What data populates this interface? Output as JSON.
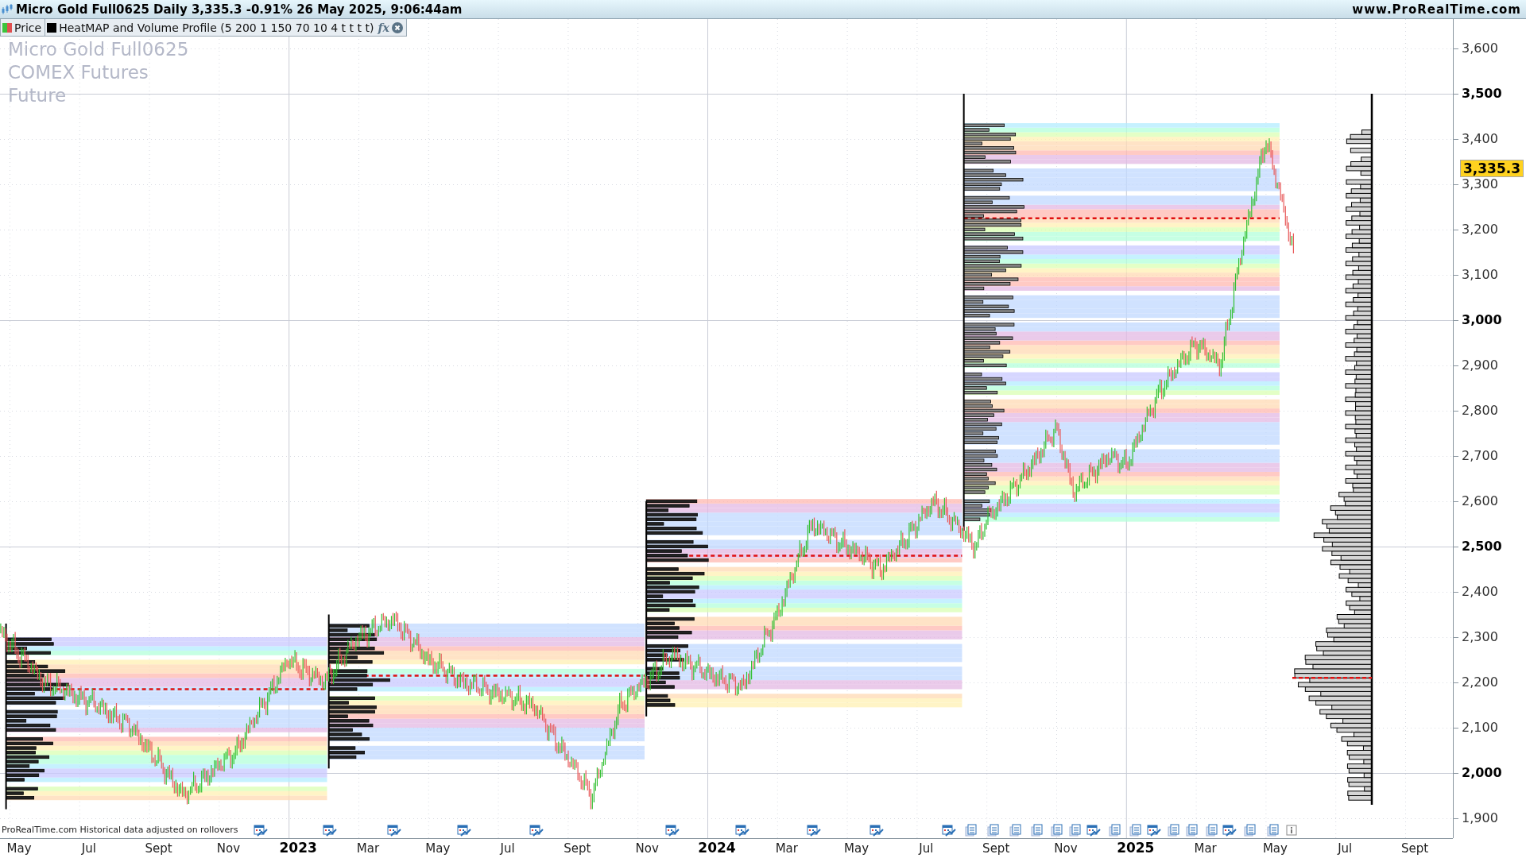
{
  "title_bar": {
    "title": "Micro Gold Full0625 Daily 3,335.3 -0.91% 26 May 2025, 9:06:44am",
    "website": "www.ProRealTime.com"
  },
  "legend": {
    "items": [
      {
        "kind": "price",
        "label": "Price"
      },
      {
        "kind": "indicator",
        "label": "HeatMAP and Volume Profile (5 200 1 150 70 10 4 t t t t)"
      }
    ],
    "formula_icon": "fx"
  },
  "watermark": [
    "Micro Gold Full0625",
    "COMEX Futures",
    "Future"
  ],
  "y_axis": {
    "labels": [
      {
        "label": "3,600",
        "major": false
      },
      {
        "label": "3,500",
        "major": true
      },
      {
        "label": "3,400",
        "major": false
      },
      {
        "label": "3,300",
        "major": false
      },
      {
        "label": "3,200",
        "major": false
      },
      {
        "label": "3,100",
        "major": false
      },
      {
        "label": "3,000",
        "major": true
      },
      {
        "label": "2,900",
        "major": false
      },
      {
        "label": "2,800",
        "major": false
      },
      {
        "label": "2,700",
        "major": false
      },
      {
        "label": "2,600",
        "major": false
      },
      {
        "label": "2,500",
        "major": true
      },
      {
        "label": "2,400",
        "major": false
      },
      {
        "label": "2,300",
        "major": false
      },
      {
        "label": "2,200",
        "major": false
      },
      {
        "label": "2,100",
        "major": false
      },
      {
        "label": "2,000",
        "major": true
      },
      {
        "label": "1,900",
        "major": false
      }
    ],
    "last_price": "3,335.3"
  },
  "x_axis": {
    "labels": [
      {
        "label": "May",
        "year": false
      },
      {
        "label": "Jul",
        "year": false
      },
      {
        "label": "Sept",
        "year": false
      },
      {
        "label": "Nov",
        "year": false
      },
      {
        "label": "2023",
        "year": true
      },
      {
        "label": "Mar",
        "year": false
      },
      {
        "label": "May",
        "year": false
      },
      {
        "label": "Jul",
        "year": false
      },
      {
        "label": "Sept",
        "year": false
      },
      {
        "label": "Nov",
        "year": false
      },
      {
        "label": "2024",
        "year": true
      },
      {
        "label": "Mar",
        "year": false
      },
      {
        "label": "May",
        "year": false
      },
      {
        "label": "Jul",
        "year": false
      },
      {
        "label": "Sept",
        "year": false
      },
      {
        "label": "Nov",
        "year": false
      },
      {
        "label": "2025",
        "year": true
      },
      {
        "label": "Mar",
        "year": false
      },
      {
        "label": "May",
        "year": false
      },
      {
        "label": "Jul",
        "year": false
      },
      {
        "label": "Sept",
        "year": false
      }
    ]
  },
  "footnote": "ProRealTime.com Historical data adjusted on rollovers"
}
